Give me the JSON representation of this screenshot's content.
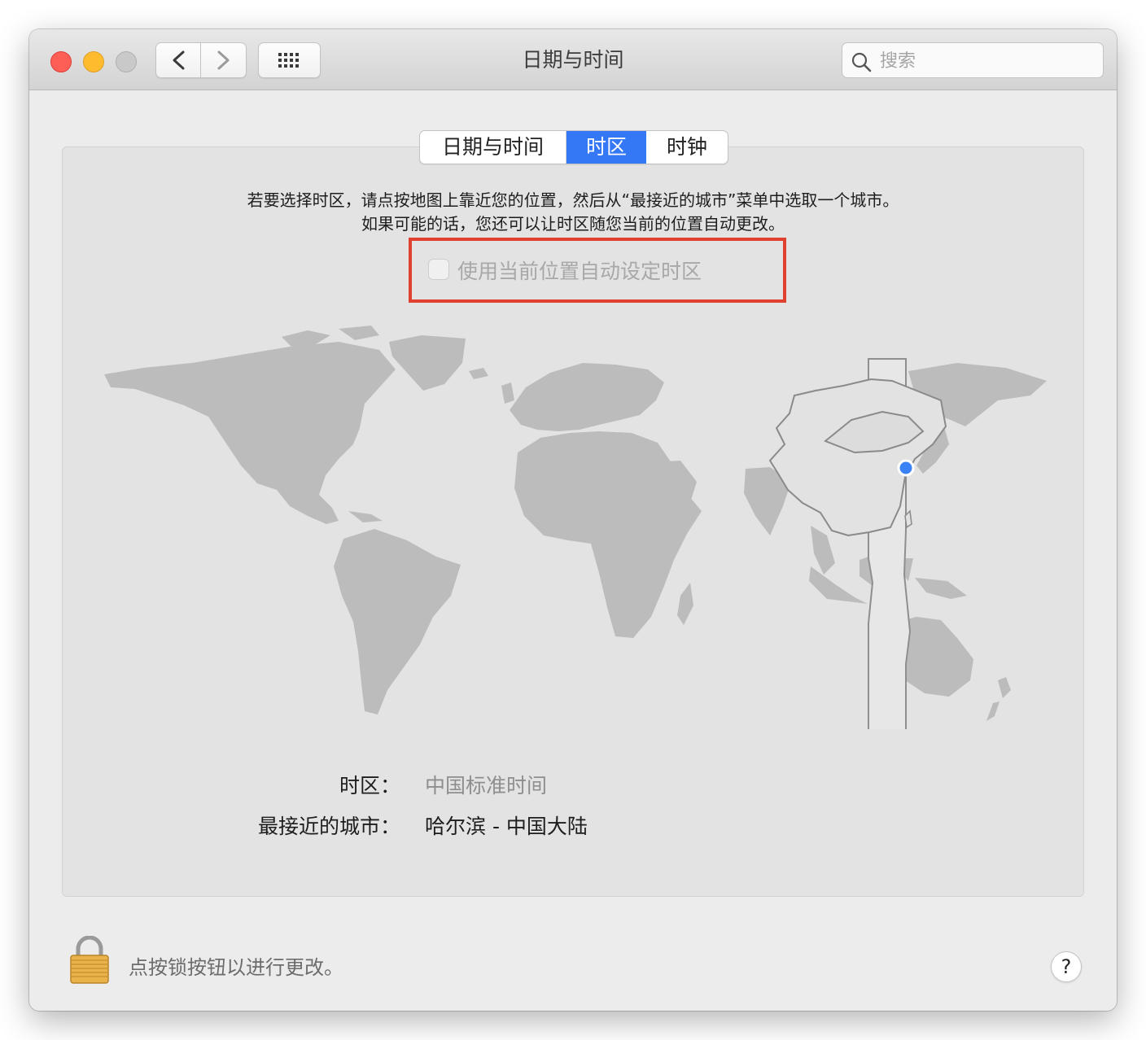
{
  "window": {
    "title": "日期与时间",
    "search_placeholder": "搜索"
  },
  "tabs": [
    {
      "label": "日期与时间",
      "selected": false
    },
    {
      "label": "时区",
      "selected": true
    },
    {
      "label": "时钟",
      "selected": false
    }
  ],
  "instructions": {
    "line1": "若要选择时区，请点按地图上靠近您的位置，然后从“最接近的城市”菜单中选取一个城市。",
    "line2": "如果可能的话，您还可以让时区随您当前的位置自动更改。"
  },
  "auto_timezone": {
    "label": "使用当前位置自动设定时区",
    "checked": false,
    "enabled": false
  },
  "info": {
    "timezone_label": "时区：",
    "timezone_value": "中国标准时间",
    "city_label": "最接近的城市：",
    "city_value": "哈尔滨 - 中国大陆"
  },
  "footer": {
    "lock_text": "点按锁按钮以进行更改。",
    "help_label": "?"
  },
  "colors": {
    "accent": "#3478f6",
    "highlight_box": "#e0402f",
    "location_dot": "#3b82f6"
  }
}
